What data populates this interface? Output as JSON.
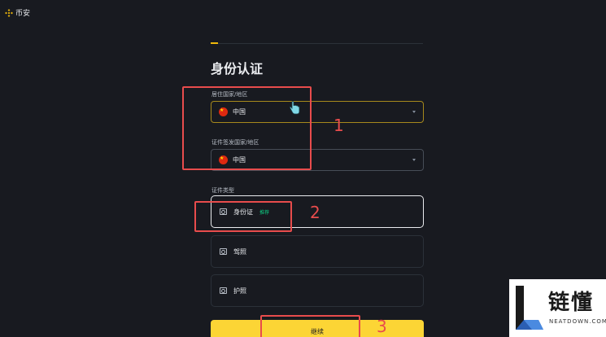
{
  "header": {
    "logo_text": "币安",
    "logo_icon": "binance-logo-icon"
  },
  "page": {
    "title": "身份认证",
    "accent_color": "#f0b90b"
  },
  "residence": {
    "label": "居住国家/地区",
    "value": "中国",
    "flag_icon": "china-flag-icon"
  },
  "issuing": {
    "label": "证件签发国家/地区",
    "value": "中国",
    "flag_icon": "china-flag-icon"
  },
  "doc_type": {
    "label": "证件类型",
    "options": [
      {
        "label": "身份证",
        "badge": "推荐",
        "icon": "id-card-icon",
        "selected": true
      },
      {
        "label": "驾照",
        "icon": "driver-license-icon",
        "selected": false
      },
      {
        "label": "护照",
        "icon": "passport-icon",
        "selected": false
      }
    ]
  },
  "continue_label": "继续",
  "annotations": {
    "n1": "1",
    "n2": "2",
    "n3": "3",
    "color": "#e84c4c"
  },
  "watermark": {
    "title": "链懂",
    "sub": "NEATDOWN.COM"
  }
}
